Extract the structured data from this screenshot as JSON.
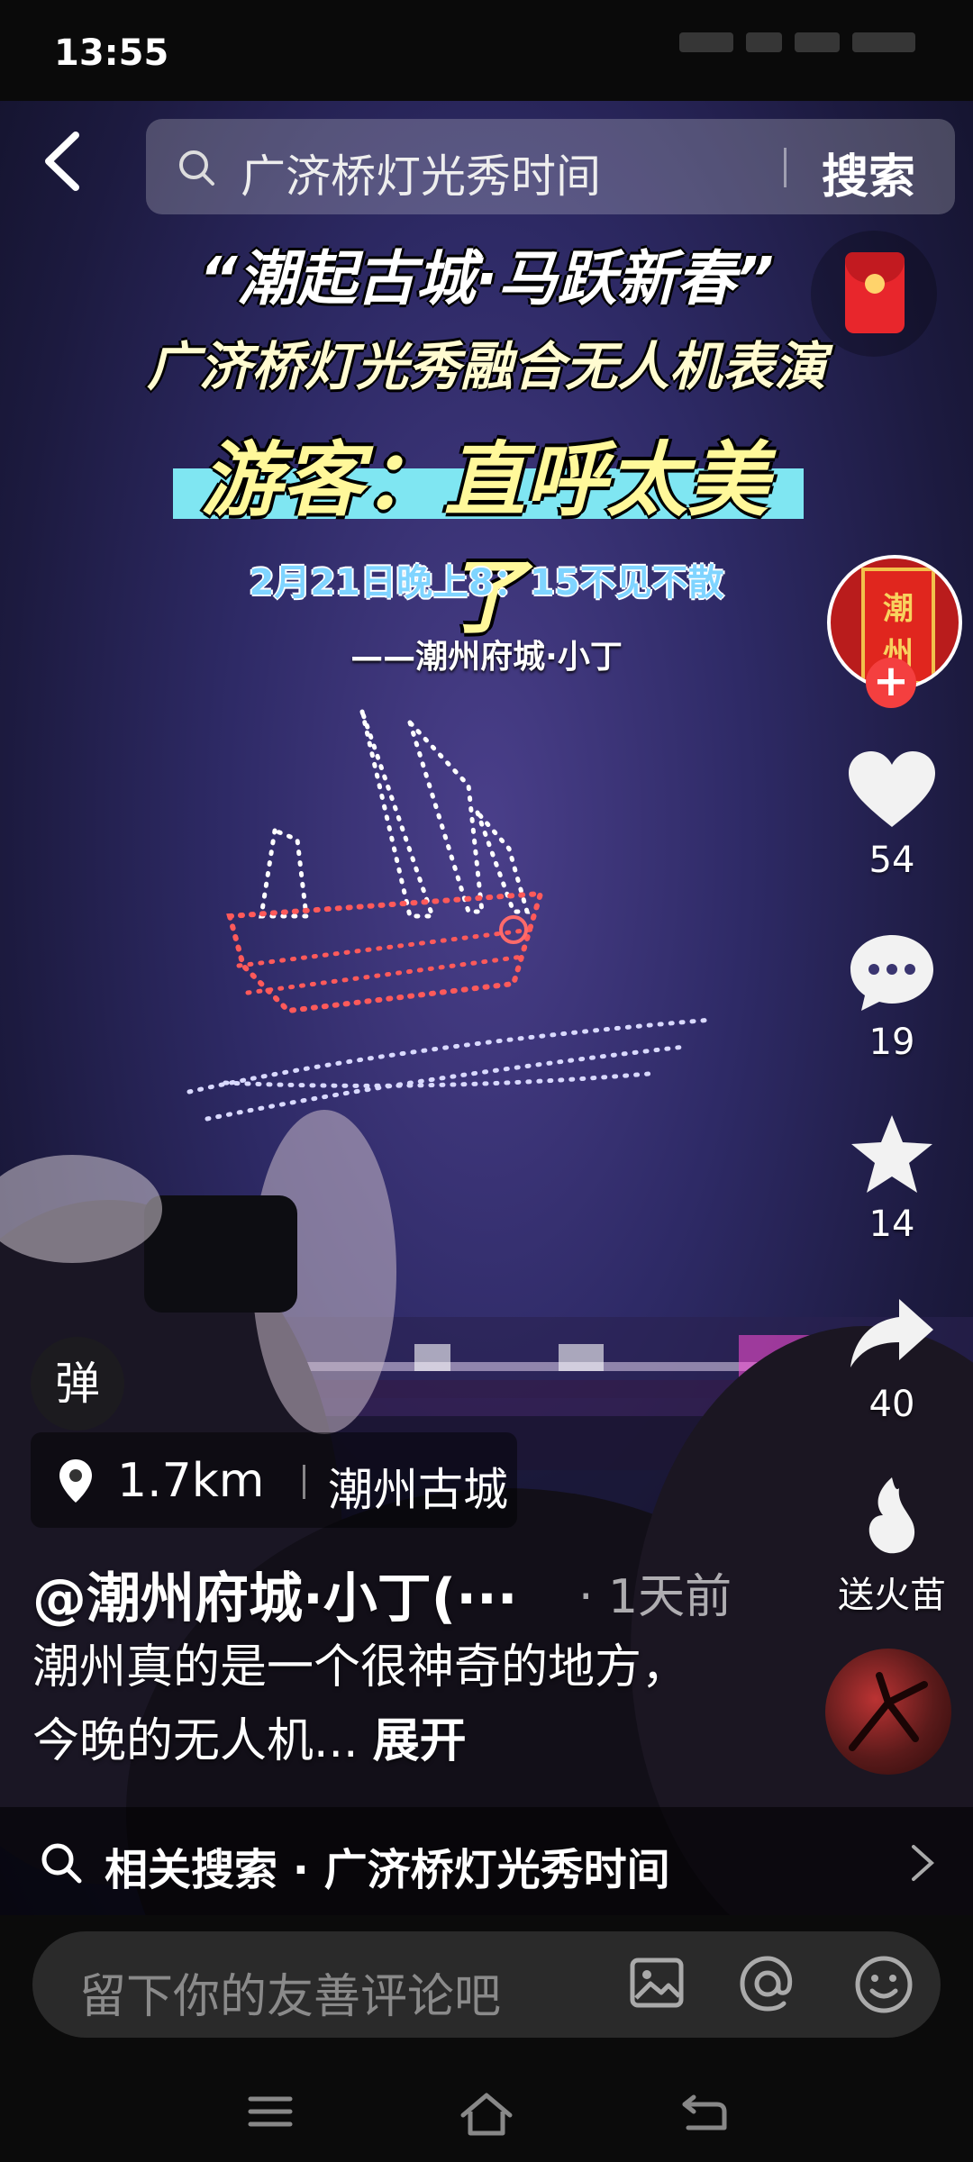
{
  "status": {
    "time": "13:55"
  },
  "search": {
    "query": "广济桥灯光秀时间",
    "button": "搜索"
  },
  "overlay": {
    "title1": "“潮起古城·马跃新春”",
    "title2": "广济桥灯光秀融合无人机表演",
    "highlight": "游客：直呼太美了",
    "date": "2月21日晚上8：15不见不散",
    "author": "——潮州府城·小丁"
  },
  "avatar": {
    "chars": [
      "潮",
      "州"
    ]
  },
  "actions": {
    "likes": "54",
    "comments": "19",
    "favorites": "14",
    "shares": "40",
    "fire_label": "送火苗"
  },
  "danmu": {
    "label": "弹"
  },
  "location": {
    "distance": "1.7km",
    "place": "潮州古城"
  },
  "post": {
    "author": "@潮州府城·小丁(···",
    "time": "· 1天前",
    "description": "潮州真的是一个很神奇的地方，今晚的无人机...",
    "more": "展开"
  },
  "related": {
    "label": "相关搜索 · 广济桥灯光秀时间"
  },
  "comment": {
    "placeholder": "留下你的友善评论吧"
  },
  "colors": {
    "accent_red": "#f43f3f",
    "highlight_cyan": "#7fe6f2",
    "highlight_yellow": "#fff89a"
  }
}
